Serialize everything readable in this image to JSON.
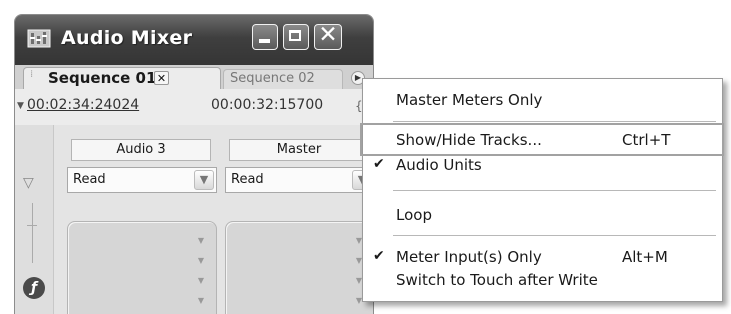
{
  "window": {
    "title": "Audio Mixer",
    "icon": "audio-mixer-app-icon",
    "controls": {
      "minimize": "minimize-icon",
      "maximize": "maximize-icon",
      "close": "close-icon"
    }
  },
  "tabs": [
    {
      "label": "Sequence 01",
      "active": true,
      "close_icon": "close-icon"
    },
    {
      "label": "Sequence 02",
      "active": false
    }
  ],
  "tab_menu_icon": "panel-menu-icon",
  "timecode": {
    "current": "00:02:34:24024",
    "duration": "00:00:32:15700"
  },
  "channels": [
    {
      "name": "Audio 3",
      "automation": "Read"
    },
    {
      "name": "Master",
      "automation": "Read"
    }
  ],
  "menu": {
    "items": [
      {
        "label": "Master Meters Only",
        "shortcut": "",
        "checked": false
      },
      {
        "label": "Show/Hide Tracks...",
        "shortcut": "Ctrl+T",
        "checked": false,
        "hovered": true
      },
      {
        "label": "Audio Units",
        "shortcut": "",
        "checked": true
      },
      {
        "label": "Loop",
        "shortcut": "",
        "checked": false
      },
      {
        "label": "Meter Input(s) Only",
        "shortcut": "Alt+M",
        "checked": true
      },
      {
        "label": "Switch to Touch after Write",
        "shortcut": "",
        "checked": false
      }
    ],
    "check_glyph": "✔"
  },
  "colors": {
    "titlebar": "#3f3f3f",
    "menu_bg": "#ffffff",
    "panel_bg": "#d5d5d5"
  }
}
